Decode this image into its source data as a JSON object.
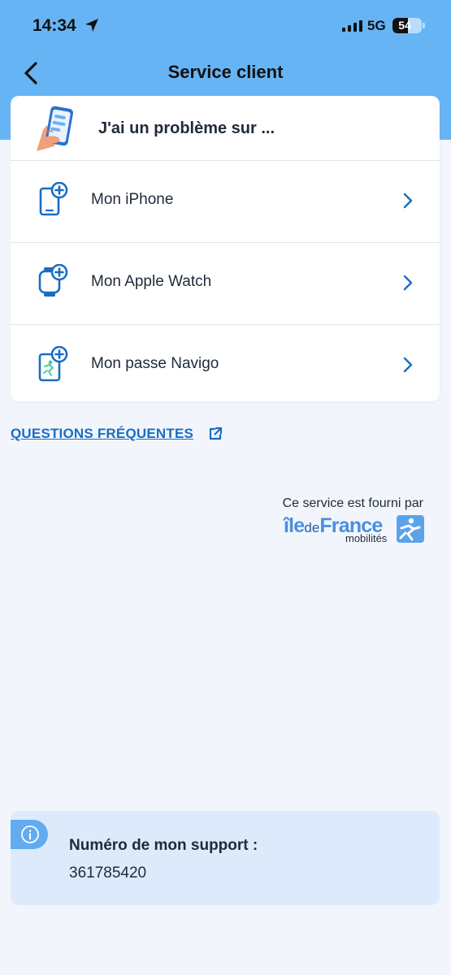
{
  "status_bar": {
    "time": "14:34",
    "network": "5G",
    "battery": "54",
    "battery_level": 0.54
  },
  "header": {
    "title": "Service client",
    "back_icon": "chevron-left-icon"
  },
  "problem_card": {
    "title": "J'ai un problème sur ...",
    "illustration": "hand-holding-phone-illustration",
    "items": [
      {
        "label": "Mon iPhone",
        "icon": "phone-plus-icon"
      },
      {
        "label": "Mon Apple Watch",
        "icon": "watch-plus-icon"
      },
      {
        "label": "Mon passe Navigo",
        "icon": "navigo-card-plus-icon"
      }
    ]
  },
  "faq": {
    "label": "QUESTIONS FRÉQUENTES",
    "icon": "external-link-icon"
  },
  "provider": {
    "text": "Ce service est fourni par",
    "logo_word_1": "île",
    "logo_word_2": "de",
    "logo_word_3": "France",
    "logo_sub": "mobilités"
  },
  "support": {
    "label": "Numéro de mon support :",
    "number": "361785420",
    "icon": "info-icon"
  },
  "colors": {
    "header_bg": "#67b4f5",
    "page_bg": "#f2f6fc",
    "accent": "#1a6dc4",
    "support_bg": "#ddeafb"
  }
}
